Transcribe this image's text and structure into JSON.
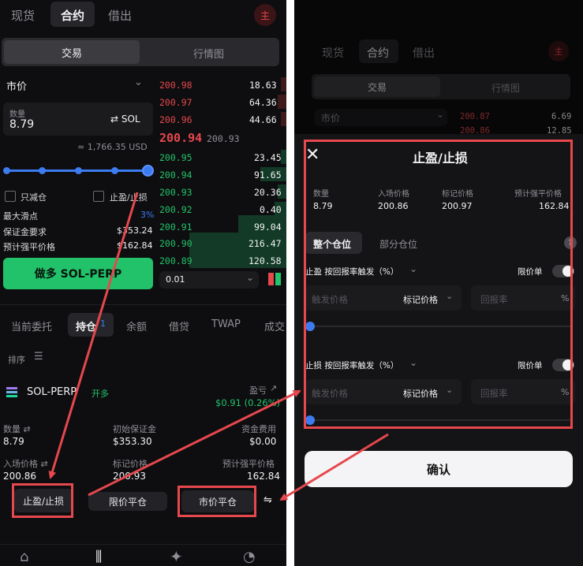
{
  "left": {
    "top_tabs": [
      "现货",
      "合约",
      "借出"
    ],
    "avatar": "主",
    "segment": {
      "trade": "交易",
      "chart": "行情图"
    },
    "order_type": "市价",
    "qty_label": "数量",
    "qty_value": "8.79",
    "qty_unit": "⇄ SOL",
    "usd_approx": "≈ 1,766.35 USD",
    "slider_fraction": 1.0,
    "reduce_only": "只减仓",
    "tp_sl": "止盈/止损",
    "rows": [
      {
        "label": "最大滑点",
        "value": "3%"
      },
      {
        "label": "保证金要求",
        "value": "$353.24"
      },
      {
        "label": "预计强平价格",
        "value": "$162.84"
      }
    ],
    "long_button": "做多 SOL-PERP",
    "asks": [
      {
        "price": "200.98",
        "size": "18.63"
      },
      {
        "price": "200.97",
        "size": "64.36"
      },
      {
        "price": "200.96",
        "size": "44.66"
      }
    ],
    "mid_price": "200.94",
    "mark_price": "200.93",
    "bids": [
      {
        "price": "200.95",
        "size": "23.45"
      },
      {
        "price": "200.94",
        "size": "91.65"
      },
      {
        "price": "200.93",
        "size": "20.36"
      },
      {
        "price": "200.92",
        "size": "0.40"
      },
      {
        "price": "200.91",
        "size": "99.04"
      },
      {
        "price": "200.90",
        "size": "216.47"
      },
      {
        "price": "200.89",
        "size": "120.58"
      }
    ],
    "tick_size": "0.01",
    "bottom_tabs": [
      "当前委托",
      "持仓",
      "余额",
      "借贷",
      "TWAP",
      "成交"
    ],
    "position_count": "1",
    "sort_label": "排序",
    "symbol": "SOL-PERP",
    "side": "开多",
    "pnl_label": "盈亏",
    "pnl_value": "$0.91 (0.26%)",
    "pos": {
      "qty_label": "数量 ⇄",
      "qty": "8.79",
      "margin_label": "初始保证金",
      "margin": "$353.30",
      "funding_label": "资金费用",
      "funding": "$0.00",
      "entry_label": "入场价格 ⇄",
      "entry": "200.86",
      "mark_label": "标记价格",
      "mark": "200.93",
      "liq_label": "预计强平价格",
      "liq": "162.84"
    },
    "actions": [
      "止盈/止损",
      "限价平仓",
      "市价平仓"
    ]
  },
  "right": {
    "top_tabs": [
      "现货",
      "合约",
      "借出"
    ],
    "avatar": "主",
    "segment": {
      "trade": "交易",
      "chart": "行情图"
    },
    "order_type": "市价",
    "asks": [
      {
        "price": "200.87",
        "size": "6.69"
      },
      {
        "price": "200.86",
        "size": "12.85"
      }
    ],
    "sheet_title": "止盈/止损",
    "info": [
      {
        "label": "数量",
        "value": "8.79"
      },
      {
        "label": "入场价格",
        "value": "200.86"
      },
      {
        "label": "标记价格",
        "value": "200.97"
      },
      {
        "label": "预计强平价格",
        "value": "162.84"
      }
    ],
    "mode_tabs": [
      "整个仓位",
      "部分仓位"
    ],
    "tp": {
      "label": "止盈 按回报率触发（%）",
      "limit_label": "限价单",
      "trigger_placeholder": "触发价格",
      "ref": "标记价格",
      "roe_placeholder": "回报率",
      "unit": "%"
    },
    "sl": {
      "label": "止损 按回报率触发（%）",
      "limit_label": "限价单",
      "trigger_placeholder": "触发价格",
      "ref": "标记价格",
      "roe_placeholder": "回报率",
      "unit": "%"
    },
    "confirm": "确认"
  },
  "colors": {
    "accent_red": "#e5484d",
    "green": "#23c26b",
    "slider_blue": "#3d7cf0"
  }
}
